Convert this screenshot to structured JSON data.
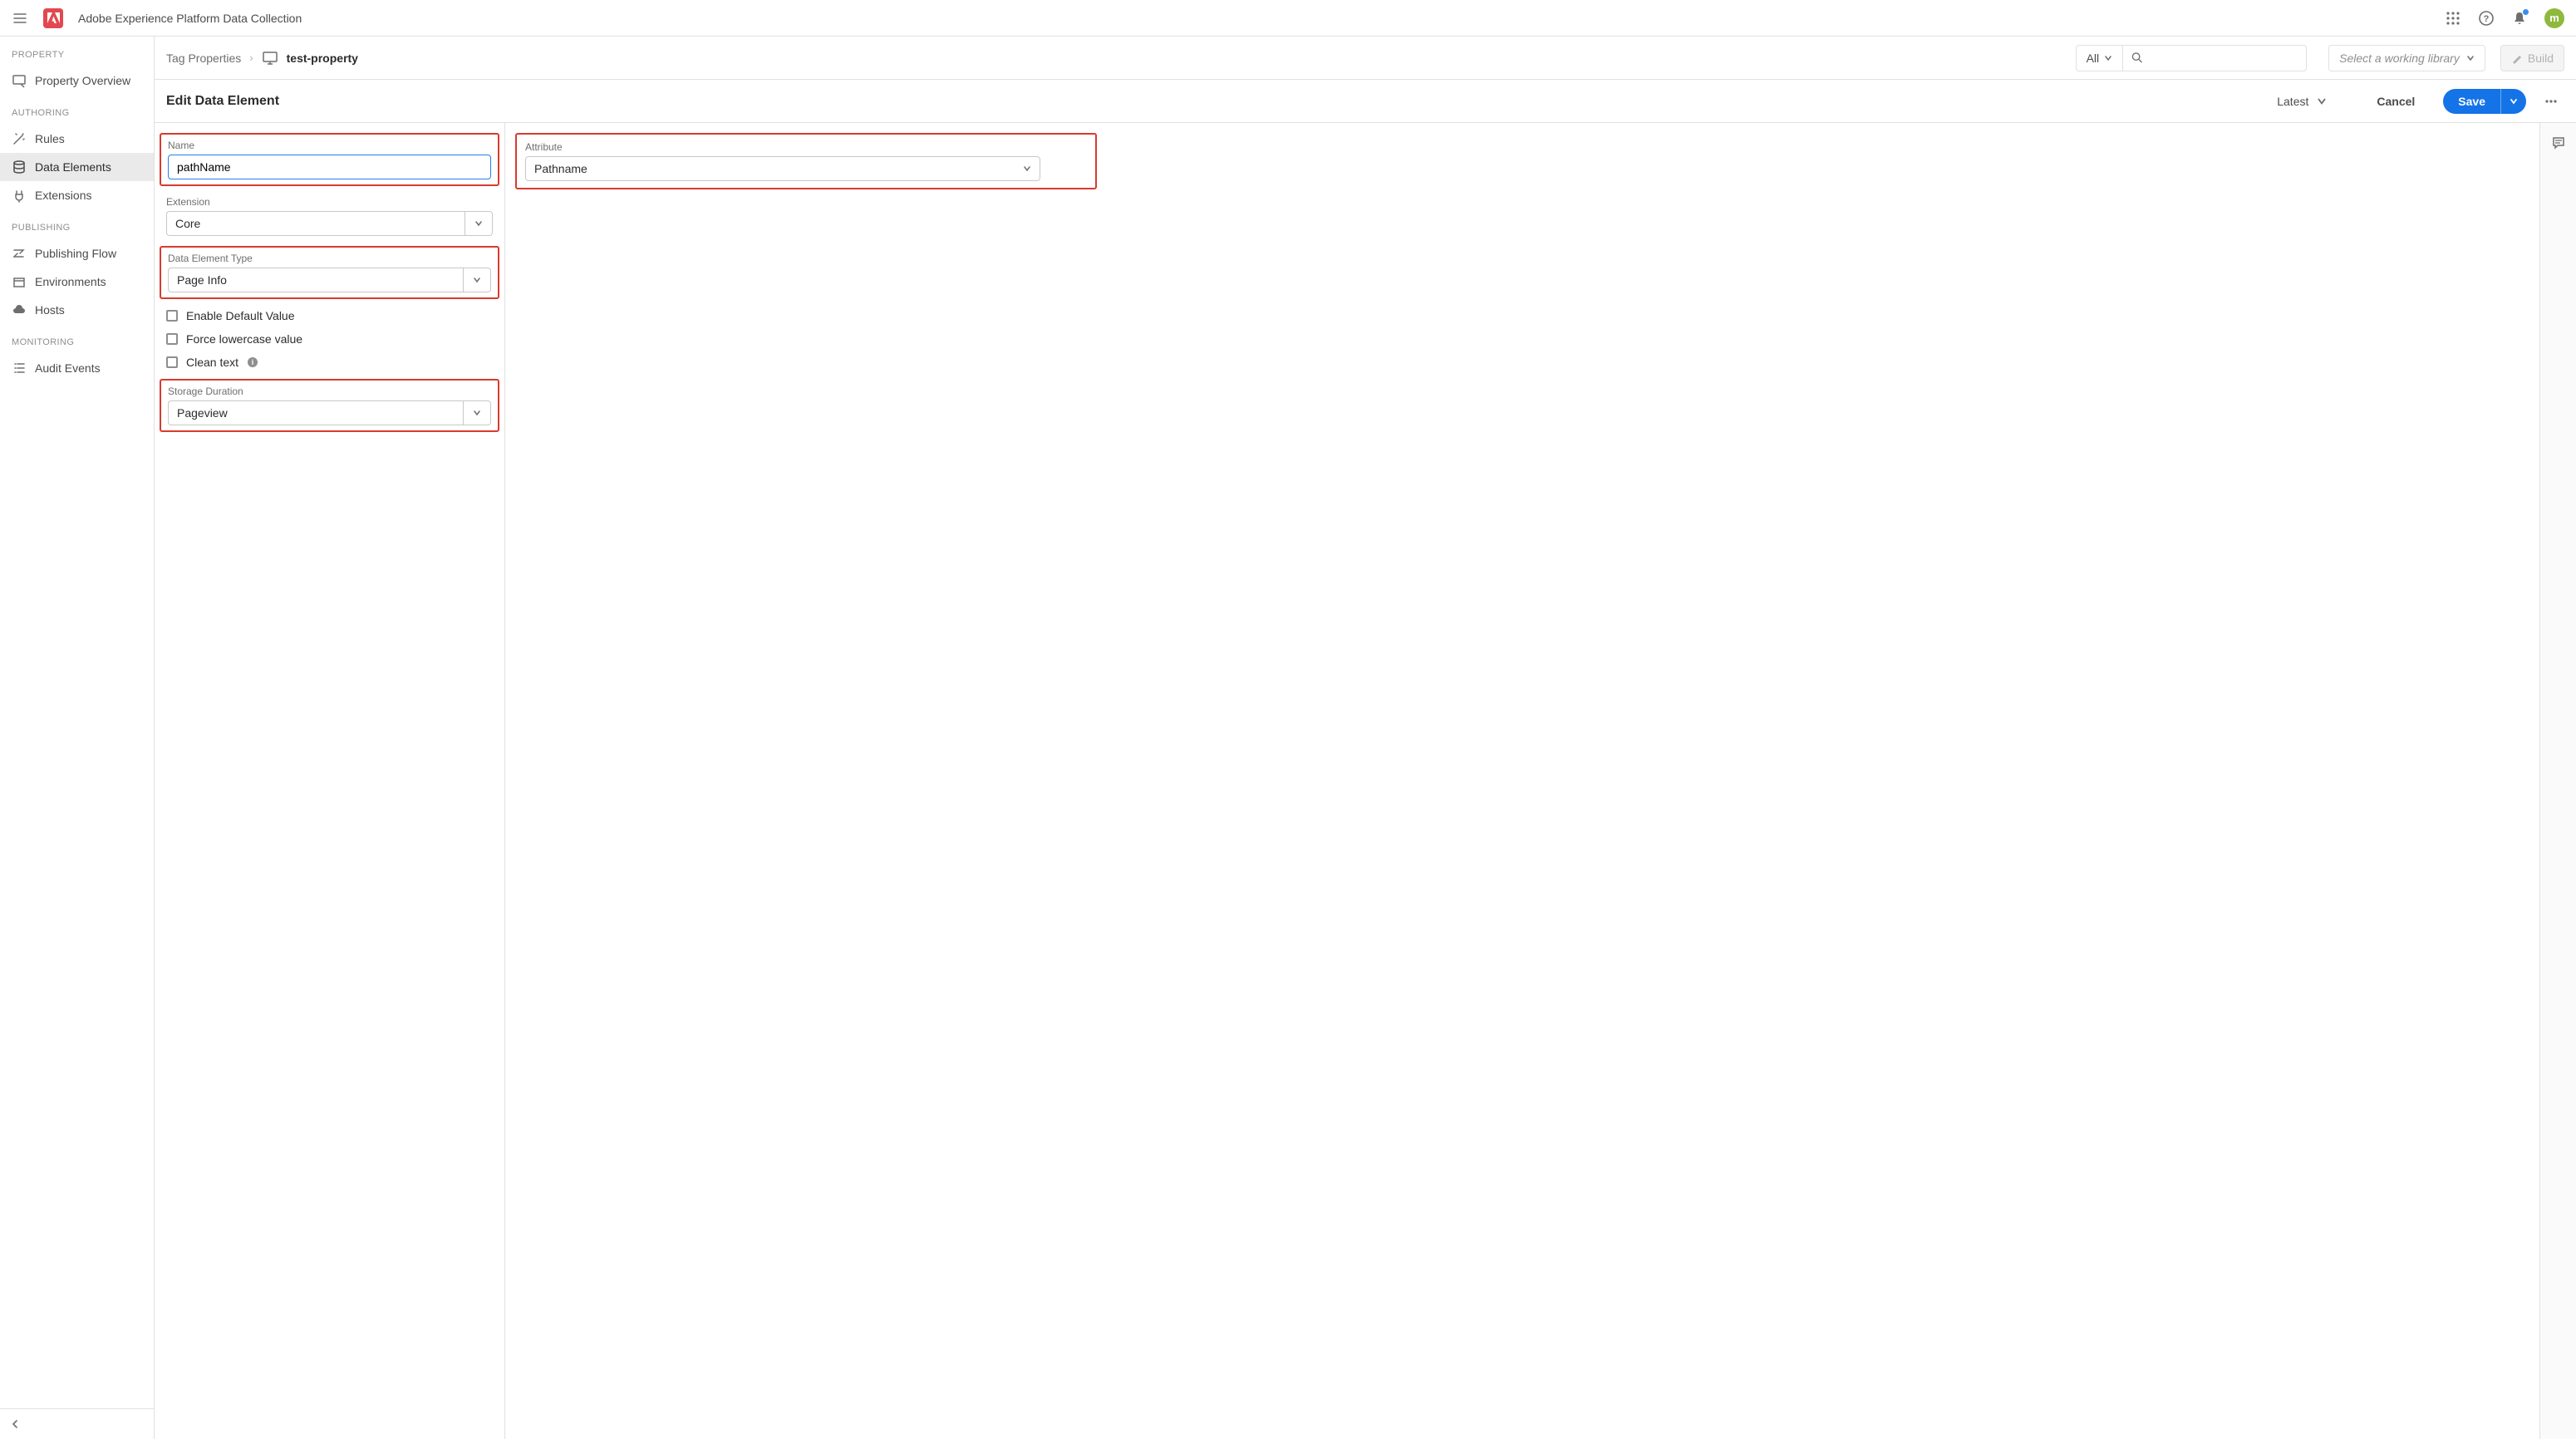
{
  "app": {
    "title": "Adobe Experience Platform Data Collection",
    "logo_letter": "A",
    "avatar_letter": "m"
  },
  "sidebar": {
    "sections": {
      "property": "PROPERTY",
      "authoring": "AUTHORING",
      "publishing": "PUBLISHING",
      "monitoring": "MONITORING"
    },
    "items": {
      "property_overview": "Property Overview",
      "rules": "Rules",
      "data_elements": "Data Elements",
      "extensions": "Extensions",
      "publishing_flow": "Publishing Flow",
      "environments": "Environments",
      "hosts": "Hosts",
      "audit_events": "Audit Events"
    }
  },
  "breadcrumb": {
    "root": "Tag Properties",
    "property_name": "test-property"
  },
  "propbar": {
    "filter_all": "All",
    "library_placeholder": "Select a working library",
    "build_label": "Build"
  },
  "edit": {
    "title": "Edit Data Element",
    "latest_label": "Latest",
    "cancel_label": "Cancel",
    "save_label": "Save"
  },
  "form": {
    "name_label": "Name",
    "name_value": "pathName",
    "extension_label": "Extension",
    "extension_value": "Core",
    "de_type_label": "Data Element Type",
    "de_type_value": "Page Info",
    "enable_default_value": "Enable Default Value",
    "force_lowercase": "Force lowercase value",
    "clean_text": "Clean text",
    "storage_duration_label": "Storage Duration",
    "storage_duration_value": "Pageview",
    "attribute_label": "Attribute",
    "attribute_value": "Pathname"
  }
}
